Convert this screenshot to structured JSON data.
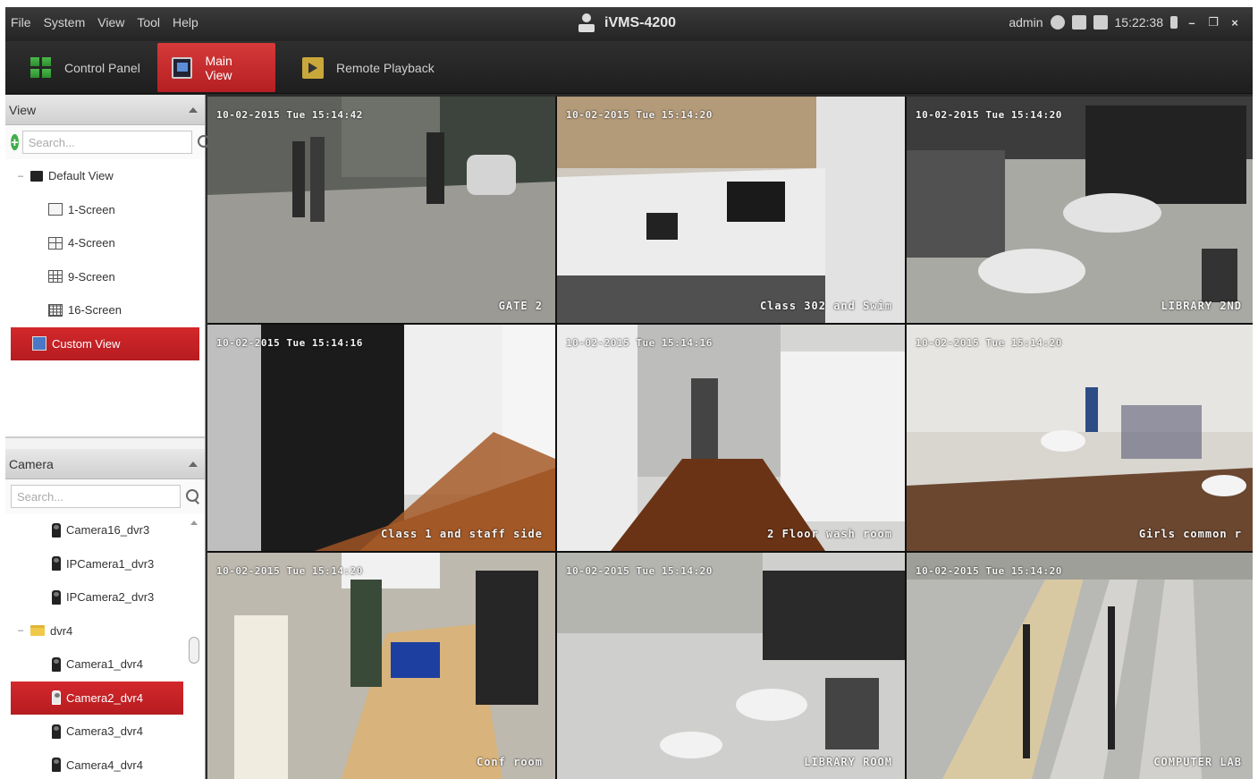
{
  "titlebar": {
    "menu": [
      "File",
      "System",
      "View",
      "Tool",
      "Help"
    ],
    "app_title": "iVMS-4200",
    "user": "admin",
    "time": "15:22:38"
  },
  "tabs": [
    {
      "label": "Control Panel"
    },
    {
      "label": "Main View",
      "active": true
    },
    {
      "label": "Remote Playback"
    }
  ],
  "view_panel": {
    "header": "View",
    "search_placeholder": "Search...",
    "group": "Default View",
    "items": [
      "1-Screen",
      "4-Screen",
      "9-Screen",
      "16-Screen"
    ],
    "selected_item": "Custom View"
  },
  "camera_panel": {
    "header": "Camera",
    "search_placeholder": "Search...",
    "items_before_group": [
      "Camera16_dvr3",
      "IPCamera1_dvr3",
      "IPCamera2_dvr3"
    ],
    "group": "dvr4",
    "group_items": [
      "Camera1_dvr4",
      "Camera2_dvr4",
      "Camera3_dvr4",
      "Camera4_dvr4"
    ],
    "selected_item": "Camera2_dvr4"
  },
  "tiles": [
    {
      "timestamp": "10-02-2015 Tue 15:14:42",
      "label": "GATE 2"
    },
    {
      "timestamp": "10-02-2015 Tue 15:14:20",
      "label": "Class 302 and Swim"
    },
    {
      "timestamp": "10-02-2015 Tue 15:14:20",
      "label": "LIBRARY 2ND"
    },
    {
      "timestamp": "10-02-2015 Tue 15:14:16",
      "label": "Class 1 and staff side"
    },
    {
      "timestamp": "10-02-2015 Tue 15:14:16",
      "label": "2 Floor  wash room"
    },
    {
      "timestamp": "10-02-2015 Tue 15:14:20",
      "label": "Girls  common r"
    },
    {
      "timestamp": "10-02-2015 Tue 15:14:20",
      "label": "Conf room"
    },
    {
      "timestamp": "10-02-2015 Tue 15:14:20",
      "label": "LIBRARY ROOM"
    },
    {
      "timestamp": "10-02-2015 Tue 15:14:20",
      "label": "COMPUTER LAB"
    }
  ],
  "colors": {
    "accent_red": "#c42226",
    "titlebar_bg": "#2b2b2b",
    "panel_bg": "#f3f3f3"
  }
}
